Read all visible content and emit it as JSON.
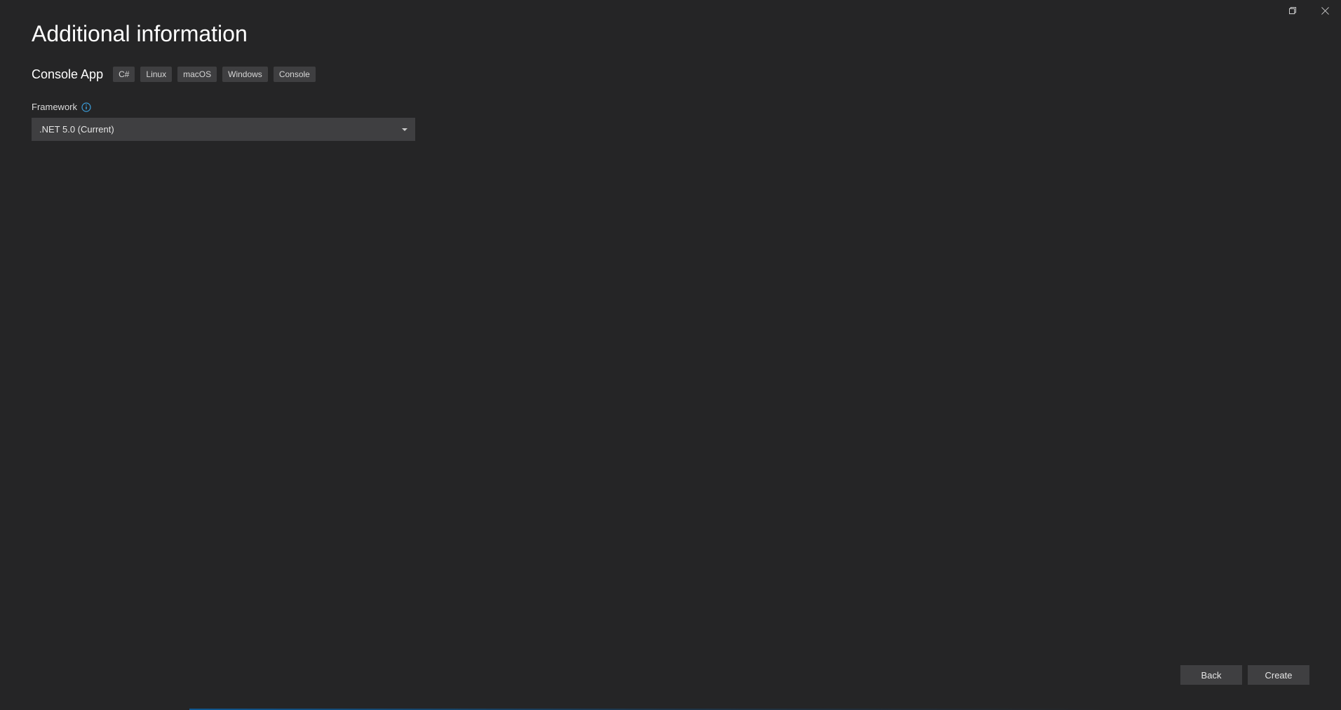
{
  "window": {
    "title": "Additional information"
  },
  "template": {
    "name": "Console App",
    "tags": [
      "C#",
      "Linux",
      "macOS",
      "Windows",
      "Console"
    ]
  },
  "form": {
    "framework": {
      "label": "Framework",
      "selected": ".NET 5.0 (Current)"
    }
  },
  "buttons": {
    "back": "Back",
    "create": "Create"
  }
}
